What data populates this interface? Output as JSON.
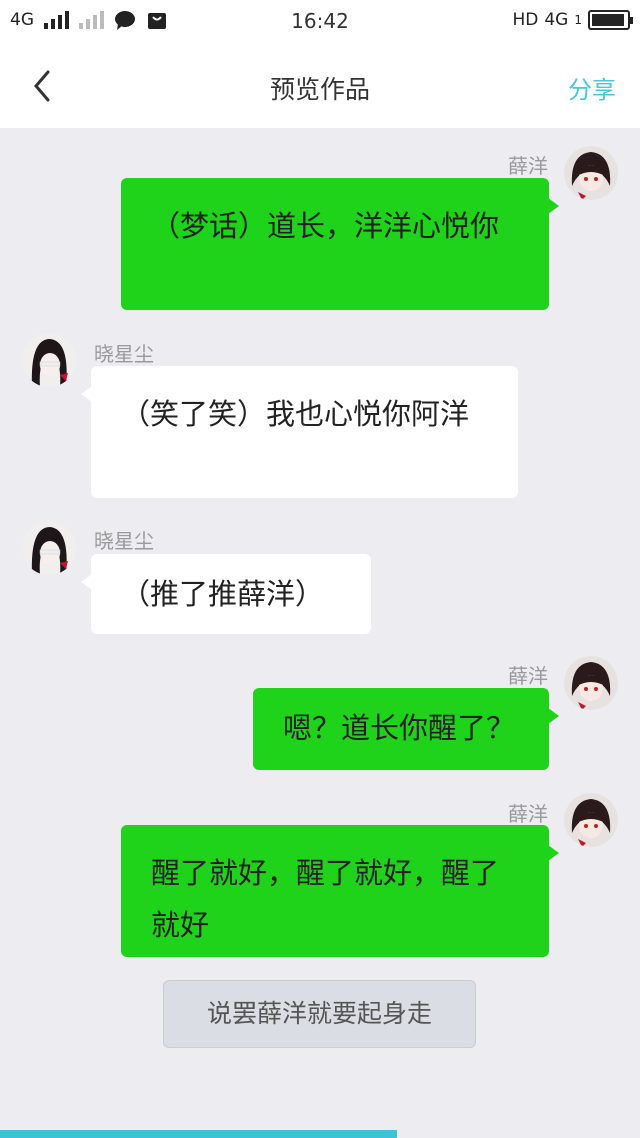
{
  "statusbar": {
    "network": "4G",
    "time": "16:42",
    "hd": "HD",
    "network_right": "4G",
    "sim": "1",
    "battery_level": 0.95
  },
  "nav": {
    "back_icon": "chevron-left-icon",
    "title": "预览作品",
    "share": "分享",
    "accent_color": "#4cc6dc"
  },
  "messages": [
    {
      "side": "right",
      "name": "薛洋",
      "text": "（梦话）道长，洋洋心悦你"
    },
    {
      "side": "left",
      "name": "晓星尘",
      "text": "（笑了笑）我也心悦你阿洋"
    },
    {
      "side": "left",
      "name": "晓星尘",
      "text": "（推了推薛洋）"
    },
    {
      "side": "right",
      "name": "薛洋",
      "text": "嗯？道长你醒了？"
    },
    {
      "side": "right",
      "name": "薛洋",
      "text": "醒了就好，醒了就好，醒了就好"
    }
  ],
  "narration": "说罢薛洋就要起身走",
  "reading_progress": 0.62,
  "colors": {
    "right_bubble": "#1fd31b",
    "left_bubble": "#ffffff",
    "background": "#ececf1"
  }
}
